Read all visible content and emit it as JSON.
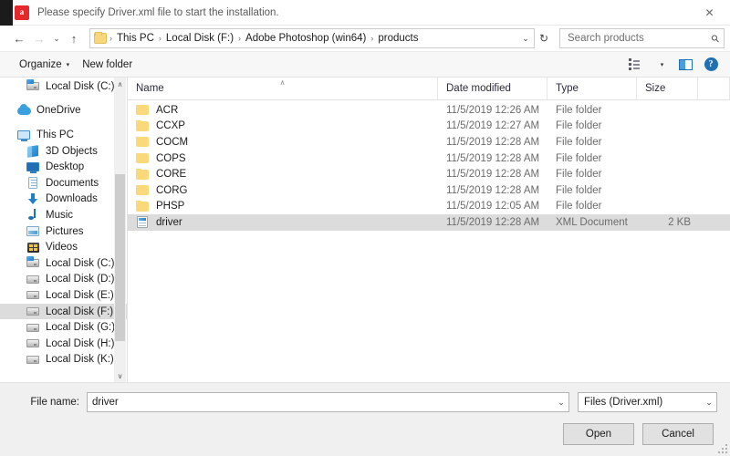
{
  "window": {
    "title": "Please specify Driver.xml file to start the installation.",
    "app_icon": "adobe-icon",
    "close_label": "✕"
  },
  "nav": {
    "back": "←",
    "forward": "→",
    "recent": "⌄",
    "up": "↑",
    "breadcrumbs": [
      "This PC",
      "Local Disk (F:)",
      "Adobe Photoshop (win64)",
      "products"
    ],
    "separator": "›",
    "dropdown": "⌄",
    "refresh": "↻",
    "search_placeholder": "Search products",
    "search_value": ""
  },
  "toolbar": {
    "organize_label": "Organize",
    "new_folder_label": "New folder",
    "caret": "▾",
    "view_icon": "list-view-icon",
    "pane_icon": "preview-pane-icon",
    "help_icon": "help-icon",
    "help_glyph": "?"
  },
  "sidebar": {
    "scroll_up": "∧",
    "scroll_down": "∨",
    "items": [
      {
        "label": "Local Disk (C:)",
        "icon": "drive-system-icon",
        "indent": 1,
        "selected": false,
        "spacer": false
      },
      {
        "label": "OneDrive",
        "icon": "cloud-icon",
        "indent": 0,
        "selected": false,
        "spacer": true
      },
      {
        "label": "This PC",
        "icon": "computer-icon",
        "indent": 0,
        "selected": false,
        "spacer": true
      },
      {
        "label": "3D Objects",
        "icon": "3d-objects-icon",
        "indent": 1,
        "selected": false,
        "spacer": false
      },
      {
        "label": "Desktop",
        "icon": "desktop-icon",
        "indent": 1,
        "selected": false,
        "spacer": false
      },
      {
        "label": "Documents",
        "icon": "documents-icon",
        "indent": 1,
        "selected": false,
        "spacer": false
      },
      {
        "label": "Downloads",
        "icon": "downloads-icon",
        "indent": 1,
        "selected": false,
        "spacer": false
      },
      {
        "label": "Music",
        "icon": "music-icon",
        "indent": 1,
        "selected": false,
        "spacer": false
      },
      {
        "label": "Pictures",
        "icon": "pictures-icon",
        "indent": 1,
        "selected": false,
        "spacer": false
      },
      {
        "label": "Videos",
        "icon": "videos-icon",
        "indent": 1,
        "selected": false,
        "spacer": false
      },
      {
        "label": "Local Disk (C:)",
        "icon": "drive-system-icon",
        "indent": 1,
        "selected": false,
        "spacer": false
      },
      {
        "label": "Local Disk (D:)",
        "icon": "drive-icon",
        "indent": 1,
        "selected": false,
        "spacer": false
      },
      {
        "label": "Local Disk (E:)",
        "icon": "drive-icon",
        "indent": 1,
        "selected": false,
        "spacer": false
      },
      {
        "label": "Local Disk (F:)",
        "icon": "drive-icon",
        "indent": 1,
        "selected": true,
        "spacer": false
      },
      {
        "label": "Local Disk (G:)",
        "icon": "drive-icon",
        "indent": 1,
        "selected": false,
        "spacer": false
      },
      {
        "label": "Local Disk (H:)",
        "icon": "drive-icon",
        "indent": 1,
        "selected": false,
        "spacer": false
      },
      {
        "label": "Local Disk (K:)",
        "icon": "drive-icon",
        "indent": 1,
        "selected": false,
        "spacer": false
      }
    ]
  },
  "filelist": {
    "columns": {
      "name": "Name",
      "date": "Date modified",
      "type": "Type",
      "size": "Size",
      "sort_caret": "∧"
    },
    "rows": [
      {
        "name": "ACR",
        "date": "11/5/2019 12:26 AM",
        "type": "File folder",
        "size": "",
        "icon": "folder-icon",
        "selected": false
      },
      {
        "name": "CCXP",
        "date": "11/5/2019 12:27 AM",
        "type": "File folder",
        "size": "",
        "icon": "folder-icon",
        "selected": false
      },
      {
        "name": "COCM",
        "date": "11/5/2019 12:28 AM",
        "type": "File folder",
        "size": "",
        "icon": "folder-icon",
        "selected": false
      },
      {
        "name": "COPS",
        "date": "11/5/2019 12:28 AM",
        "type": "File folder",
        "size": "",
        "icon": "folder-icon",
        "selected": false
      },
      {
        "name": "CORE",
        "date": "11/5/2019 12:28 AM",
        "type": "File folder",
        "size": "",
        "icon": "folder-icon",
        "selected": false
      },
      {
        "name": "CORG",
        "date": "11/5/2019 12:28 AM",
        "type": "File folder",
        "size": "",
        "icon": "folder-icon",
        "selected": false
      },
      {
        "name": "PHSP",
        "date": "11/5/2019 12:05 AM",
        "type": "File folder",
        "size": "",
        "icon": "folder-icon",
        "selected": false
      },
      {
        "name": "driver",
        "date": "11/5/2019 12:28 AM",
        "type": "XML Document",
        "size": "2 KB",
        "icon": "xml-document-icon",
        "selected": true
      }
    ]
  },
  "bottom": {
    "filename_label": "File name:",
    "filename_value": "driver",
    "filename_caret": "⌄",
    "filetype_value": "Files (Driver.xml)",
    "filetype_caret": "⌄",
    "open_label": "Open",
    "cancel_label": "Cancel"
  }
}
